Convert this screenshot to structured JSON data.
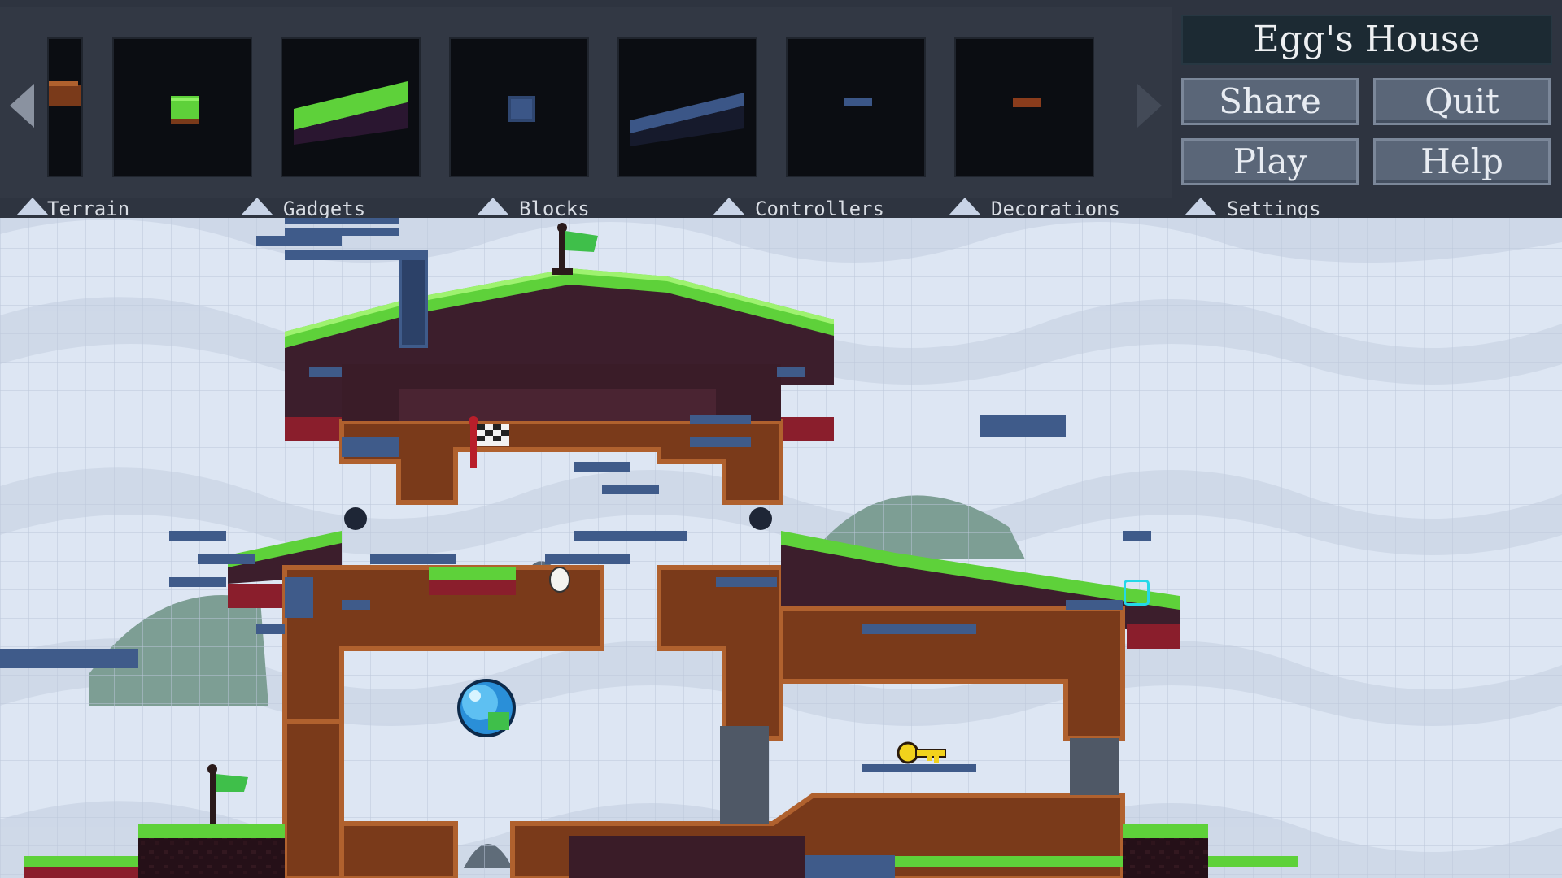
{
  "level": {
    "title": "Egg's House"
  },
  "menu": {
    "share_label": "Share",
    "quit_label": "Quit",
    "play_label": "Play",
    "help_label": "Help"
  },
  "categories": [
    {
      "label": "Terrain"
    },
    {
      "label": "Gadgets"
    },
    {
      "label": "Blocks"
    },
    {
      "label": "Controllers"
    },
    {
      "label": "Decorations"
    },
    {
      "label": "Settings"
    }
  ],
  "palette": {
    "items": [
      {
        "icon": "dirt-tile-partial-icon"
      },
      {
        "icon": "grass-block-icon"
      },
      {
        "icon": "grass-slope-icon"
      },
      {
        "icon": "blue-block-icon"
      },
      {
        "icon": "blue-slope-icon"
      },
      {
        "icon": "blue-platform-icon"
      },
      {
        "icon": "brown-platform-icon"
      }
    ]
  },
  "colors": {
    "grass": "#5ed13a",
    "dirt": "#7a3a1a",
    "stone_blue": "#3f5b8a",
    "sky_grid": "#dde6f3",
    "cursor": "#23d8e8"
  }
}
